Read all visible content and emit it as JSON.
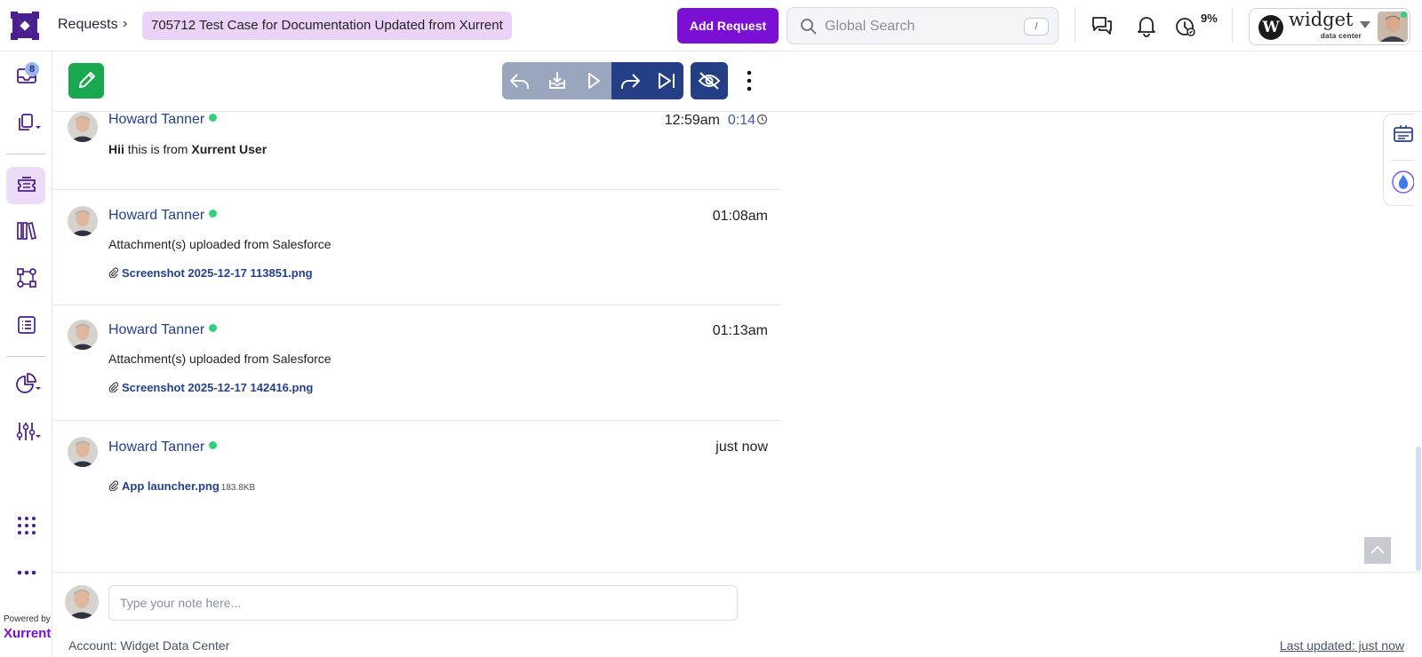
{
  "header": {
    "breadcrumb": "Requests",
    "ticket_chip": "705712  Test Case for Documentation Updated from Xurrent",
    "add_request_label": "Add Request",
    "search_placeholder": "Global Search",
    "search_shortcut": "/",
    "timer_percent": "9%",
    "account": {
      "brand": "widget",
      "brand_sub": "data center"
    }
  },
  "sidebar": {
    "inbox_badge": "8",
    "powered_by": "Powered by",
    "brand": "Xurrent",
    "active_item": "requests-icon"
  },
  "toolbar": {
    "buttons": [
      "reply-icon",
      "download-icon",
      "play-icon",
      "forward-icon",
      "skip-end-icon",
      "eye-off-icon",
      "more-vertical-icon"
    ]
  },
  "notes": [
    {
      "author": "Howard Tanner",
      "time": "12:59am",
      "duration": "0:14",
      "body_parts": [
        "Hii",
        " this is from ",
        "Xurrent User"
      ]
    },
    {
      "author": "Howard Tanner",
      "time": "01:08am",
      "body": "Attachment(s) uploaded from Salesforce",
      "attachment": "Screenshot 2025-12-17 113851.png"
    },
    {
      "author": "Howard Tanner",
      "time": "01:13am",
      "body": "Attachment(s) uploaded from Salesforce",
      "attachment": "Screenshot 2025-12-17 142416.png"
    },
    {
      "author": "Howard Tanner",
      "time": "just now",
      "attachment": "App launcher.png",
      "attachment_size": "183.8KB"
    }
  ],
  "composer": {
    "placeholder": "Type your note here..."
  },
  "footer": {
    "account": "Account: Widget Data Center",
    "last_updated": "Last updated: just now"
  },
  "colors": {
    "accent": "#7b0fd3",
    "link": "#24418f",
    "online": "#2fd27a",
    "edit": "#1aa84e",
    "toolbar_dark": "#253f87"
  }
}
